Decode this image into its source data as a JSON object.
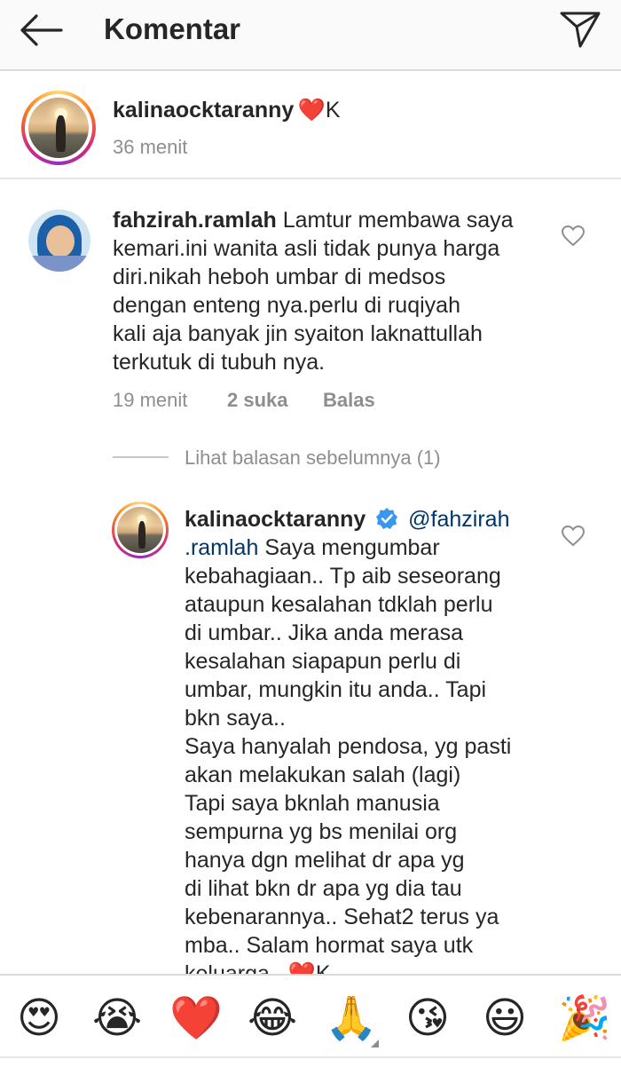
{
  "header": {
    "title": "Komentar"
  },
  "caption": {
    "username": "kalinaocktaranny",
    "text": "❤️K",
    "time": "36 menit"
  },
  "comment": {
    "username": "fahzirah.ramlah",
    "lines": [
      "Lamtur membawa saya",
      "kemari.ini wanita asli tidak punya harga",
      "diri.nikah heboh umbar di medsos",
      "dengan enteng nya.perlu di ruqiyah",
      "kali aja banyak jin syaiton laknattullah",
      "terkutuk di tubuh nya."
    ],
    "time": "19 menit",
    "likes": "2 suka",
    "reply_label": "Balas"
  },
  "view_replies": "Lihat balasan sebelumnya (1)",
  "reply": {
    "username": "kalinaocktaranny",
    "mention": "@fahzirah",
    "lines": [
      ".ramlah",
      "kebahagiaan.. Tp aib seseorang",
      "ataupun kesalahan tdklah perlu",
      "di umbar.. Jika anda merasa",
      "kesalahan siapapun perlu di",
      "umbar, mungkin itu anda.. Tapi",
      "bkn saya..",
      "Saya hanyalah pendosa, yg pasti",
      "akan melakukan salah (lagi)",
      "Tapi saya bknlah manusia",
      "sempurna yg bs menilai org",
      "hanya dgn melihat dr apa yg",
      "di lihat bkn dr apa yg dia tau",
      "kebenarannya.. Sehat2 terus ya",
      "mba.. Salam hormat saya utk",
      "keluarga.. ❤️K"
    ],
    "line1_rest": " Saya mengumbar"
  },
  "emojis": [
    "😍",
    "😭",
    "❤️",
    "😂",
    "🙏",
    "😘",
    "😃",
    "🎉"
  ],
  "colors": {
    "link_blue": "#003569",
    "verified_blue": "#3897f0",
    "heart_red": "#ed4956",
    "meta_gray": "#8e8e8e"
  }
}
